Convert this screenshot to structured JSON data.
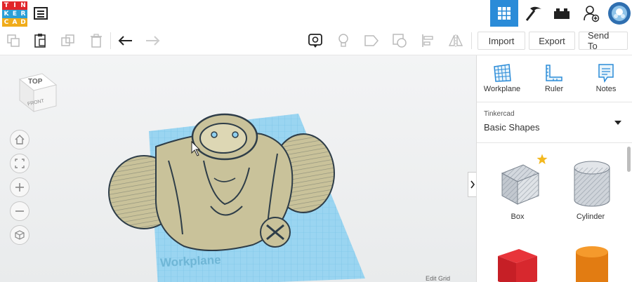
{
  "logo": {
    "letters": [
      "T",
      "I",
      "N",
      "K",
      "E",
      "R",
      "C",
      "A",
      "D"
    ],
    "colors": [
      "#e1252a",
      "#e1252a",
      "#e1252a",
      "#2b9fd6",
      "#2b9fd6",
      "#2b9fd6",
      "#f0ac1b",
      "#f0ac1b",
      "#f0ac1b"
    ]
  },
  "topbar": {
    "icons": [
      "list-icon",
      "3d-design-icon",
      "codeblocks-icon",
      "bricks-icon",
      "add-user-icon",
      "avatar"
    ]
  },
  "toolbar": {
    "import_label": "Import",
    "export_label": "Export",
    "sendto_label": "Send To"
  },
  "viewcube": {
    "top": "TOP",
    "front": "FRONT"
  },
  "canvas": {
    "workplane_label": "Workplane",
    "edit_grid_label": "Edit Grid"
  },
  "panel": {
    "tools": [
      {
        "label": "Workplane"
      },
      {
        "label": "Ruler"
      },
      {
        "label": "Notes"
      }
    ],
    "library_title": "Tinkercad",
    "library_value": "Basic Shapes",
    "shapes": [
      {
        "label": "Box"
      },
      {
        "label": "Cylinder"
      }
    ]
  },
  "colors": {
    "accent": "#2a8bd8",
    "model": "#c9c29a",
    "grid": "#8fd0ef"
  }
}
